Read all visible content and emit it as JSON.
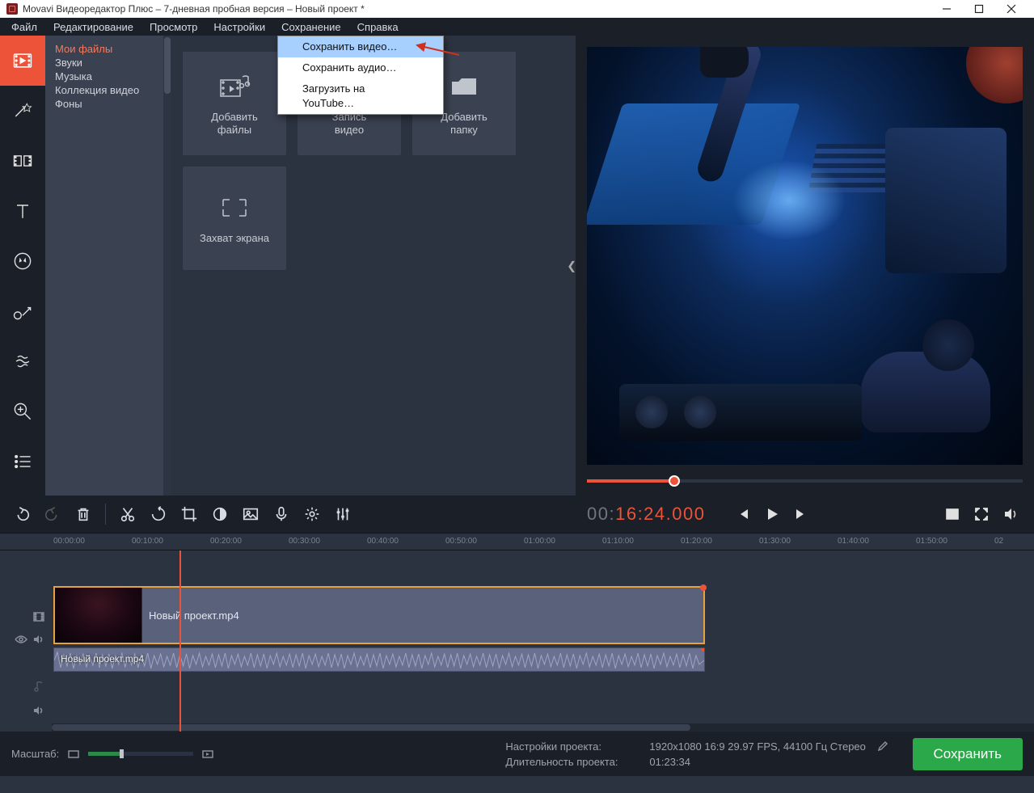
{
  "titlebar": {
    "title": "Movavi Видеоредактор Плюс – 7-дневная пробная версия – Новый проект *"
  },
  "menubar": {
    "items": [
      "Файл",
      "Редактирование",
      "Просмотр",
      "Настройки",
      "Сохранение",
      "Справка"
    ]
  },
  "dropdown": {
    "items": [
      "Сохранить видео…",
      "Сохранить аудио…",
      "Загрузить на YouTube…"
    ],
    "highlighted_index": 0
  },
  "sources": {
    "items": [
      "Мои файлы",
      "Звуки",
      "Музыка",
      "Коллекция видео",
      "Фоны"
    ],
    "selected_index": 0
  },
  "import_tiles": {
    "add_files": "Добавить\nфайлы",
    "record_video": "Запись\nвидео",
    "add_folder": "Добавить\nпапку",
    "screen_capture": "Захват экрана"
  },
  "timecode": {
    "prefix": "00:",
    "main": "16:24.000"
  },
  "ruler_ticks": [
    "00:00:00",
    "00:10:00",
    "00:20:00",
    "00:30:00",
    "00:40:00",
    "00:50:00",
    "01:00:00",
    "01:10:00",
    "01:20:00",
    "01:30:00",
    "01:40:00",
    "01:50:00",
    "02"
  ],
  "clips": {
    "video_name": "Новый проект.mp4",
    "audio_name": "Новый проект.mp4"
  },
  "bottom": {
    "zoom_label": "Масштаб:",
    "settings_label": "Настройки проекта:",
    "settings_value": "1920x1080 16:9 29.97 FPS, 44100 Гц Стерео",
    "duration_label": "Длительность проекта:",
    "duration_value": "01:23:34",
    "save_button": "Сохранить"
  }
}
